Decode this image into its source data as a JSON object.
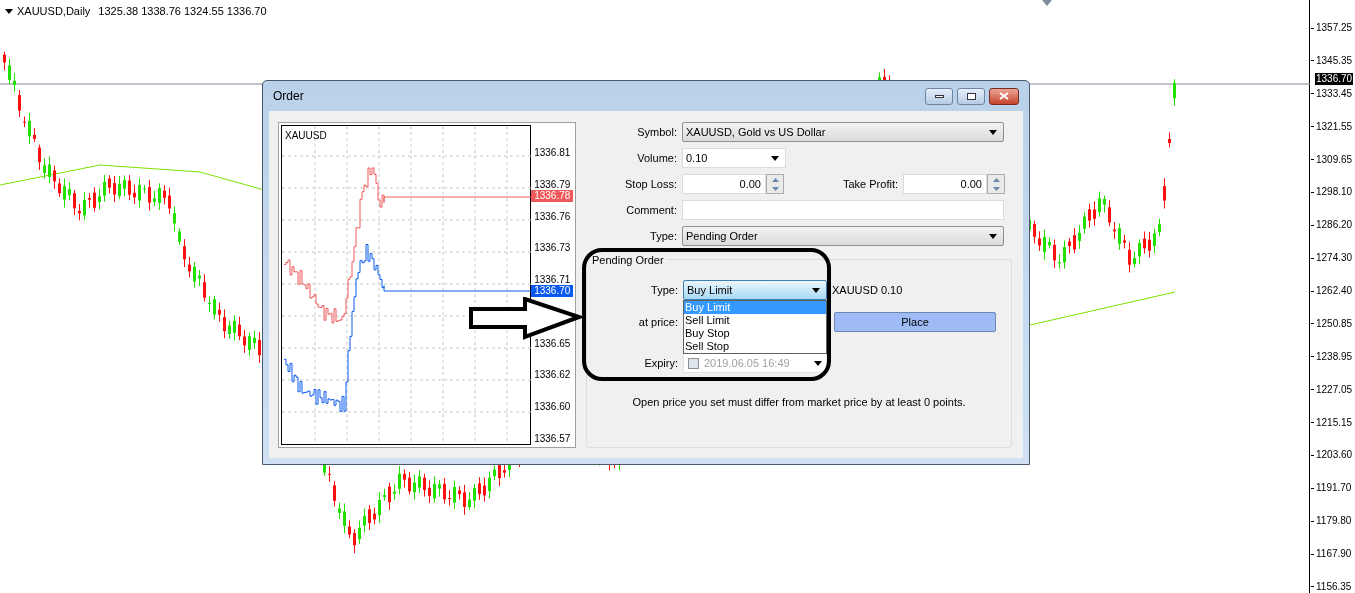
{
  "chart": {
    "symbol": "XAUUSD,Daily",
    "ohlc": "1325.38 1338.76 1324.55 1336.70",
    "current_price": "1336.70",
    "price_labels": [
      "1357.25",
      "1345.35",
      "1333.45",
      "1321.55",
      "1309.65",
      "1298.10",
      "1286.20",
      "1274.30",
      "1262.40",
      "1250.85",
      "1238.95",
      "1227.05",
      "1215.15",
      "1203.60",
      "1191.70",
      "1179.80",
      "1167.90",
      "1156.35"
    ]
  },
  "dialog": {
    "title": "Order",
    "tick_chart": {
      "symbol": "XAUUSD",
      "ask": "1336.78",
      "bid": "1336.70",
      "price_labels": [
        "1336.81",
        "1336.79",
        "1336.76",
        "1336.73",
        "1336.71",
        "1336.65",
        "1336.62",
        "1336.60",
        "1336.57"
      ]
    },
    "symbol": {
      "label": "Symbol:",
      "value": "XAUUSD, Gold vs US Dollar"
    },
    "volume": {
      "label": "Volume:",
      "value": "0.10"
    },
    "stop_loss": {
      "label": "Stop Loss:",
      "value": "0.00"
    },
    "take_profit": {
      "label": "Take Profit:",
      "value": "0.00"
    },
    "comment": {
      "label": "Comment:"
    },
    "type": {
      "label": "Type:",
      "value": "Pending Order"
    },
    "pending": {
      "title": "Pending Order",
      "type": {
        "label": "Type:",
        "value": "Buy Limit",
        "expanded": true,
        "options": [
          {
            "label": "Buy Limit",
            "selected": true
          },
          {
            "label": "Sell Limit",
            "selected": false
          },
          {
            "label": "Buy Stop",
            "selected": false
          },
          {
            "label": "Sell Stop",
            "selected": false
          }
        ]
      },
      "summary": "XAUUSD 0.10",
      "at_price": {
        "label": "at price:"
      },
      "place_button": "Place",
      "expiry": {
        "label": "Expiry:",
        "value": "2019.06.05 16:49",
        "checked": false
      },
      "note": "Open price you set must differ from market price by at least 0 points."
    }
  }
}
